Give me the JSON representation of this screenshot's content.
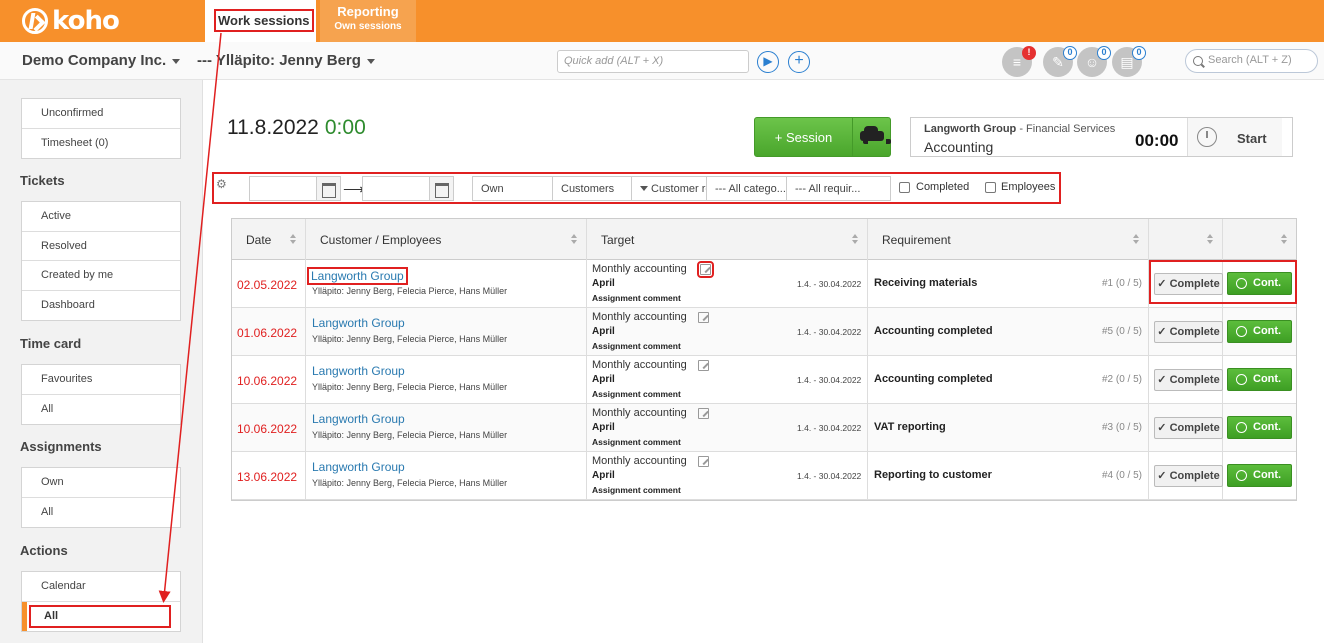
{
  "header": {
    "logo_text": "koho",
    "tabs": [
      {
        "label": "Work sessions",
        "sub": ""
      },
      {
        "label": "Reporting",
        "sub": "Own sessions"
      }
    ]
  },
  "subbar": {
    "company": "Demo Company Inc.",
    "maintenance": "--- Ylläpito: Jenny Berg",
    "quick_add_placeholder": "Quick add (ALT + X)",
    "badges": [
      "!",
      "0",
      "0",
      "0"
    ],
    "search_placeholder": "Search (ALT + Z)"
  },
  "sidebar": {
    "top": [
      "Unconfirmed",
      "Timesheet (0)"
    ],
    "tickets": {
      "heading": "Tickets",
      "items": [
        "Active",
        "Resolved",
        "Created by me",
        "Dashboard"
      ]
    },
    "timecard": {
      "heading": "Time card",
      "items": [
        "Favourites",
        "All"
      ]
    },
    "assignments": {
      "heading": "Assignments",
      "items": [
        "Own",
        "All"
      ]
    },
    "actions": {
      "heading": "Actions",
      "items": [
        "Calendar",
        "All"
      ]
    }
  },
  "main": {
    "date": "11.8.2022",
    "time": "0:00",
    "session_button": "+ Session",
    "timer": {
      "customer": "Langworth Group",
      "customer_type": "- Financial Services",
      "task": "Accounting",
      "value": "00:00",
      "start_label": "Start"
    },
    "filters": {
      "own": "Own",
      "customers": "Customers",
      "customer_req": "Customer re",
      "all_categories": "--- All catego...",
      "all_requirements": "--- All requir...",
      "completed_label": "Completed",
      "employees_label": "Employees"
    },
    "table": {
      "columns": [
        "Date",
        "Customer / Employees",
        "Target",
        "Requirement",
        "",
        ""
      ],
      "rows": [
        {
          "date": "02.05.2022",
          "customer": "Langworth Group",
          "employees": "Ylläpito: Jenny Berg, Felecia Pierce, Hans Müller",
          "target": "Monthly accounting",
          "month": "April",
          "comment": "Assignment comment",
          "range": "1.4. - 30.04.2022",
          "requirement": "Receiving materials",
          "req_num": "#1 (0 / 5)",
          "complete": "✓ Complete",
          "cont": "Cont."
        },
        {
          "date": "01.06.2022",
          "customer": "Langworth Group",
          "employees": "Ylläpito: Jenny Berg, Felecia Pierce, Hans Müller",
          "target": "Monthly accounting",
          "month": "April",
          "comment": "Assignment comment",
          "range": "1.4. - 30.04.2022",
          "requirement": "Accounting completed",
          "req_num": "#5 (0 / 5)",
          "complete": "✓ Complete",
          "cont": "Cont."
        },
        {
          "date": "10.06.2022",
          "customer": "Langworth Group",
          "employees": "Ylläpito: Jenny Berg, Felecia Pierce, Hans Müller",
          "target": "Monthly accounting",
          "month": "April",
          "comment": "Assignment comment",
          "range": "1.4. - 30.04.2022",
          "requirement": "Accounting completed",
          "req_num": "#2 (0 / 5)",
          "complete": "✓ Complete",
          "cont": "Cont."
        },
        {
          "date": "10.06.2022",
          "customer": "Langworth Group",
          "employees": "Ylläpito: Jenny Berg, Felecia Pierce, Hans Müller",
          "target": "Monthly accounting",
          "month": "April",
          "comment": "Assignment comment",
          "range": "1.4. - 30.04.2022",
          "requirement": "VAT reporting",
          "req_num": "#3 (0 / 5)",
          "complete": "✓ Complete",
          "cont": "Cont."
        },
        {
          "date": "13.06.2022",
          "customer": "Langworth Group",
          "employees": "Ylläpito: Jenny Berg, Felecia Pierce, Hans Müller",
          "target": "Monthly accounting",
          "month": "April",
          "comment": "Assignment comment",
          "range": "1.4. - 30.04.2022",
          "requirement": "Reporting to customer",
          "req_num": "#4 (0 / 5)",
          "complete": "✓ Complete",
          "cont": "Cont."
        }
      ]
    }
  },
  "colors": {
    "brand": "#f7902b",
    "accent_green": "#4aa62c",
    "link": "#2a7ab0",
    "date_red": "#e02020",
    "annotation": "#e02020"
  }
}
